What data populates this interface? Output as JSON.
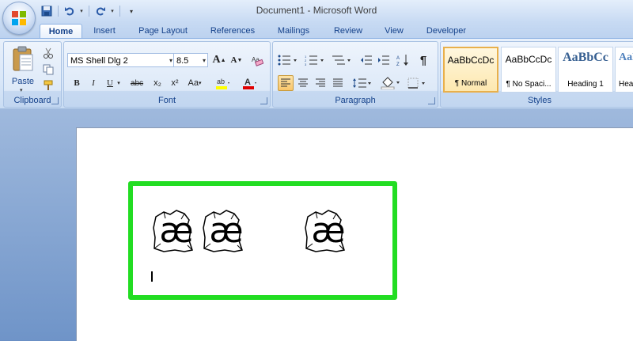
{
  "window": {
    "title": "Document1 - Microsoft Word"
  },
  "quick_access": {
    "icons": [
      "save-icon",
      "undo-icon",
      "redo-icon",
      "customize-icon"
    ]
  },
  "tabs": [
    {
      "label": "Home",
      "active": true
    },
    {
      "label": "Insert"
    },
    {
      "label": "Page Layout"
    },
    {
      "label": "References"
    },
    {
      "label": "Mailings"
    },
    {
      "label": "Review"
    },
    {
      "label": "View"
    },
    {
      "label": "Developer"
    }
  ],
  "clipboard": {
    "paste_label": "Paste",
    "group_label": "Clipboard"
  },
  "font": {
    "font_name": "MS Shell Dlg 2",
    "font_size": "8.5",
    "group_label": "Font",
    "bold": "B",
    "italic": "I",
    "underline": "U",
    "strike": "abc",
    "subscript": "x₂",
    "superscript": "x²",
    "change_case": "Aa",
    "grow": "A",
    "shrink": "A",
    "highlight_color": "#ffff00",
    "font_color": "#e00000"
  },
  "paragraph": {
    "group_label": "Paragraph",
    "pilcrow": "¶"
  },
  "styles": {
    "group_label": "Styles",
    "items": [
      {
        "sample": "AaBbCcDc",
        "name": "¶ Normal",
        "active": true
      },
      {
        "sample": "AaBbCcDc",
        "name": "¶ No Spaci..."
      },
      {
        "sample": "AaBbCc",
        "name": "Heading 1"
      },
      {
        "sample": "AaBbC",
        "name": "Hea"
      }
    ]
  },
  "document": {
    "glyphs": [
      "æ",
      "æ",
      "æ"
    ],
    "highlight_color": "#22dd22"
  }
}
